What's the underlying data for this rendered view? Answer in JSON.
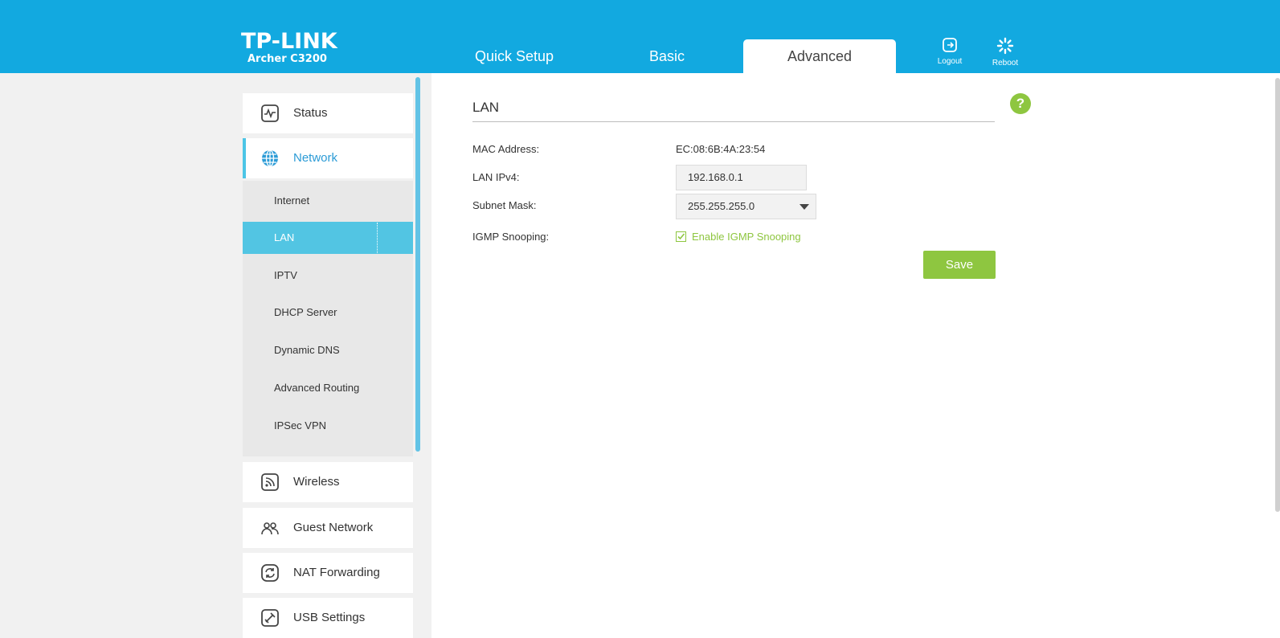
{
  "brand": {
    "logo": "TP-LINK",
    "model": "Archer C3200"
  },
  "tabs": [
    {
      "label": "Quick Setup"
    },
    {
      "label": "Basic"
    },
    {
      "label": "Advanced"
    }
  ],
  "header_buttons": {
    "logout": "Logout",
    "reboot": "Reboot"
  },
  "sidebar": {
    "items": [
      {
        "label": "Status",
        "icon": "status-icon"
      },
      {
        "label": "Network",
        "icon": "globe-icon"
      },
      {
        "label": "Wireless",
        "icon": "wireless-icon"
      },
      {
        "label": "Guest Network",
        "icon": "guest-icon"
      },
      {
        "label": "NAT Forwarding",
        "icon": "refresh-icon"
      },
      {
        "label": "USB Settings",
        "icon": "usb-icon"
      }
    ],
    "network_submenu": [
      {
        "label": "Internet"
      },
      {
        "label": "LAN"
      },
      {
        "label": "IPTV"
      },
      {
        "label": "DHCP Server"
      },
      {
        "label": "Dynamic DNS"
      },
      {
        "label": "Advanced Routing"
      },
      {
        "label": "IPSec VPN"
      }
    ]
  },
  "lan": {
    "title": "LAN",
    "help": "?",
    "mac_label": "MAC Address:",
    "mac_value": "EC:08:6B:4A:23:54",
    "ipv4_label": "LAN IPv4:",
    "ipv4_value": "192.168.0.1",
    "subnet_label": "Subnet Mask:",
    "subnet_value": "255.255.255.0",
    "igmp_label": "IGMP Snooping:",
    "igmp_checkbox": "Enable IGMP Snooping",
    "igmp_checked": true,
    "save": "Save"
  },
  "colors": {
    "header": "#12a9e0",
    "accent": "#52c5e3",
    "green": "#8ec640"
  }
}
